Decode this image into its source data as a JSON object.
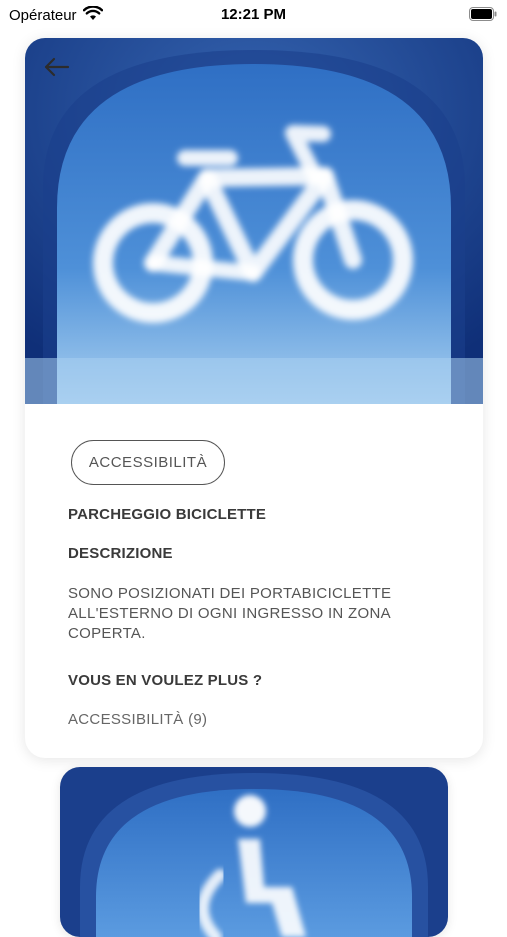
{
  "status_bar": {
    "carrier": "Opérateur",
    "time": "12:21 PM"
  },
  "hero": {
    "image_subject": "bicycle-cloud"
  },
  "detail": {
    "category_chip": "ACCESSIBILITÀ",
    "title": "PARCHEGGIO BICICLETTE",
    "description_heading": "DESCRIZIONE",
    "description_lines": [
      "SONO POSIZIONATI DEI PORTABICICLETTE",
      "ALL'ESTERNO DI OGNI INGRESSO IN ZONA",
      "COPERTA."
    ],
    "more_heading": "VOUS EN VOULEZ PLUS ?",
    "more_link": "ACCESSIBILITÀ (9)"
  },
  "next_card": {
    "image_subject": "person-cloud"
  },
  "colors": {
    "sky_top": "#2f6fc4",
    "sky_bottom": "#a9d0f0",
    "frame_dark": "#1b3f8c"
  }
}
